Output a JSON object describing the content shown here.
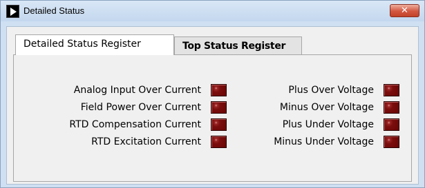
{
  "window": {
    "title": "Detailed Status",
    "close_label": "✕"
  },
  "tabs": [
    {
      "label": "Detailed Status Register",
      "active": true
    },
    {
      "label": "Top Status Register",
      "active": false
    }
  ],
  "indicators": {
    "left": [
      {
        "label": "Analog Input Over Current",
        "state": "off"
      },
      {
        "label": "Field Power Over Current",
        "state": "off"
      },
      {
        "label": "RTD Compensation Current",
        "state": "off"
      },
      {
        "label": "RTD Excitation Current",
        "state": "off"
      }
    ],
    "right": [
      {
        "label": "Plus Over Voltage",
        "state": "off"
      },
      {
        "label": "Minus Over Voltage",
        "state": "off"
      },
      {
        "label": "Plus Under Voltage",
        "state": "off"
      },
      {
        "label": "Minus Under Voltage",
        "state": "off"
      }
    ]
  },
  "colors": {
    "led_off": "#7a0d0d",
    "titlebar": "#c3d7ee",
    "close_button": "#c24328"
  }
}
